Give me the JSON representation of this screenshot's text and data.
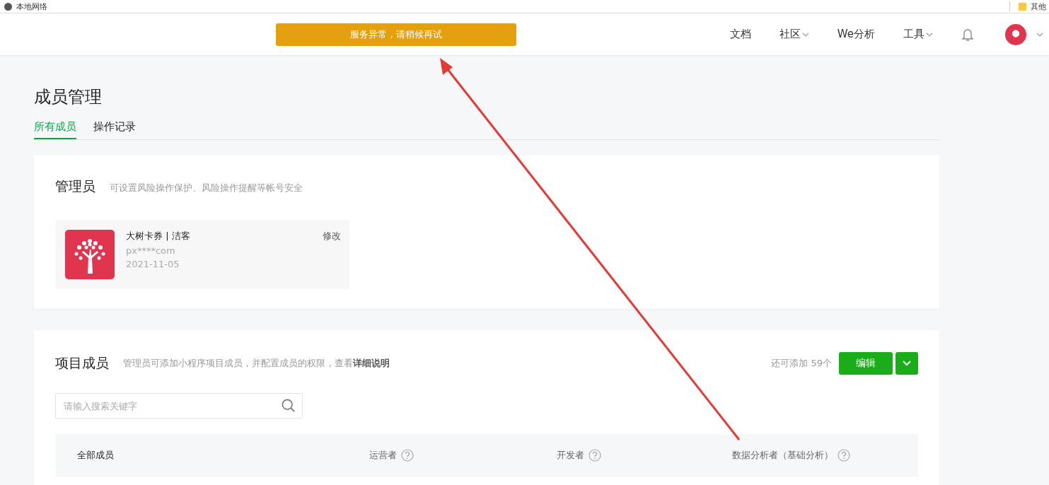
{
  "bookmarks_bar": {
    "items": [
      "本地网络",
      "其他"
    ]
  },
  "header": {
    "alert": "服务异常，请稍候再试",
    "nav": [
      {
        "label": "文档",
        "dropdown": false
      },
      {
        "label": "社区",
        "dropdown": true
      },
      {
        "label": "We分析",
        "dropdown": false
      },
      {
        "label": "工具",
        "dropdown": true
      }
    ]
  },
  "page": {
    "title": "成员管理",
    "tabs": [
      {
        "label": "所有成员",
        "selected": true
      },
      {
        "label": "操作记录",
        "selected": false
      }
    ]
  },
  "admin_card": {
    "title": "管理员",
    "description": "可设置风险操作保护、风险操作提醒等帐号安全",
    "admin": {
      "name": "大树卡券 | 洁客",
      "account": "px****com",
      "date": "2021-11-05",
      "action": "修改"
    }
  },
  "members_card": {
    "title": "项目成员",
    "description": "管理员可添加小程序项目成员，并配置成员的权限，查看**详细说明**",
    "remaining": "还可添加 59个",
    "edit_button": "编辑",
    "search": {
      "placeholder": "请输入搜索关键字"
    },
    "table": {
      "columns": [
        {
          "label": "全部成员",
          "help": false
        },
        {
          "label": "运营者",
          "help": true
        },
        {
          "label": "开发者",
          "help": true
        },
        {
          "label": "数据分析者（基础分析）",
          "help": true
        }
      ]
    }
  }
}
